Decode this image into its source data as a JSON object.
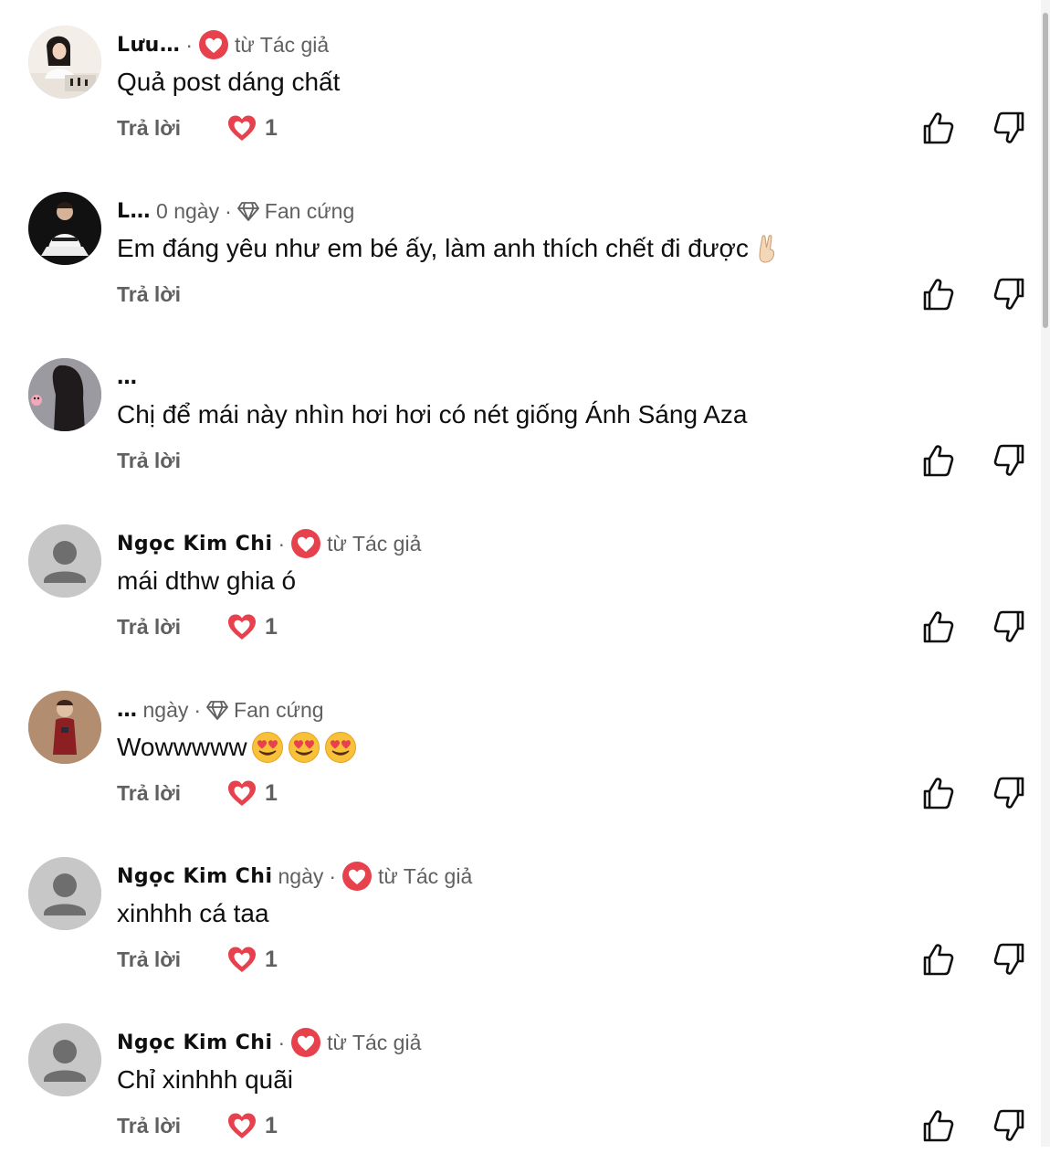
{
  "comments": [
    {
      "author": "Lưu…",
      "time": "",
      "badge": "từ Tác giả",
      "badge_type": "creator-heart",
      "text": "Quả post dáng chất",
      "reply_label": "Trả lời",
      "heart_count": "1",
      "avatar": "photo-chess",
      "emojis": []
    },
    {
      "author": "L…",
      "time": "0 ngày",
      "badge": "Fan cứng",
      "badge_type": "fan-diamond",
      "text": "Em đáng yêu như em bé ấy, làm anh thích chết đi được",
      "reply_label": "Trả lời",
      "heart_count": "",
      "avatar": "photo-taekwondo",
      "emojis": [
        "victory-hand-emoji"
      ]
    },
    {
      "author": "…",
      "time": "",
      "badge": "",
      "badge_type": "none",
      "text": "Chị để mái này nhìn hơi hơi có nét giống Ánh Sáng Aza",
      "reply_label": "Trả lời",
      "heart_count": "",
      "avatar": "photo-dark-hair",
      "emojis": []
    },
    {
      "author": "Ngọc Kim Chi",
      "time": "",
      "badge": "từ Tác giả",
      "badge_type": "creator-heart",
      "text": "mái dthw ghia ó",
      "reply_label": "Trả lời",
      "heart_count": "1",
      "avatar": "default-person",
      "emojis": []
    },
    {
      "author": "…",
      "time": "ngày",
      "badge": "Fan cứng",
      "badge_type": "fan-diamond",
      "text": "Wowwwww",
      "reply_label": "Trả lời",
      "heart_count": "1",
      "avatar": "photo-red-dress",
      "emojis": [
        "heart-eyes-emoji",
        "heart-eyes-emoji",
        "heart-eyes-emoji"
      ]
    },
    {
      "author": "Ngọc Kim Chi",
      "time": "ngày",
      "badge": "từ Tác giả",
      "badge_type": "creator-heart",
      "text": "xinhhh cá taa",
      "reply_label": "Trả lời",
      "heart_count": "1",
      "avatar": "default-person",
      "emojis": []
    },
    {
      "author": "Ngọc Kim Chi",
      "time": "",
      "badge": "từ Tác giả",
      "badge_type": "creator-heart",
      "text": "Chỉ xinhhh quãi",
      "reply_label": "Trả lời",
      "heart_count": "1",
      "avatar": "default-person",
      "emojis": []
    }
  ],
  "icons": {
    "like": "thumbs-up-icon",
    "dislike": "thumbs-down-icon",
    "heart": "heart-icon",
    "diamond": "diamond-icon"
  },
  "colors": {
    "heart": "#e8414e",
    "text_primary": "#0f0f0f",
    "text_secondary": "#606060"
  }
}
